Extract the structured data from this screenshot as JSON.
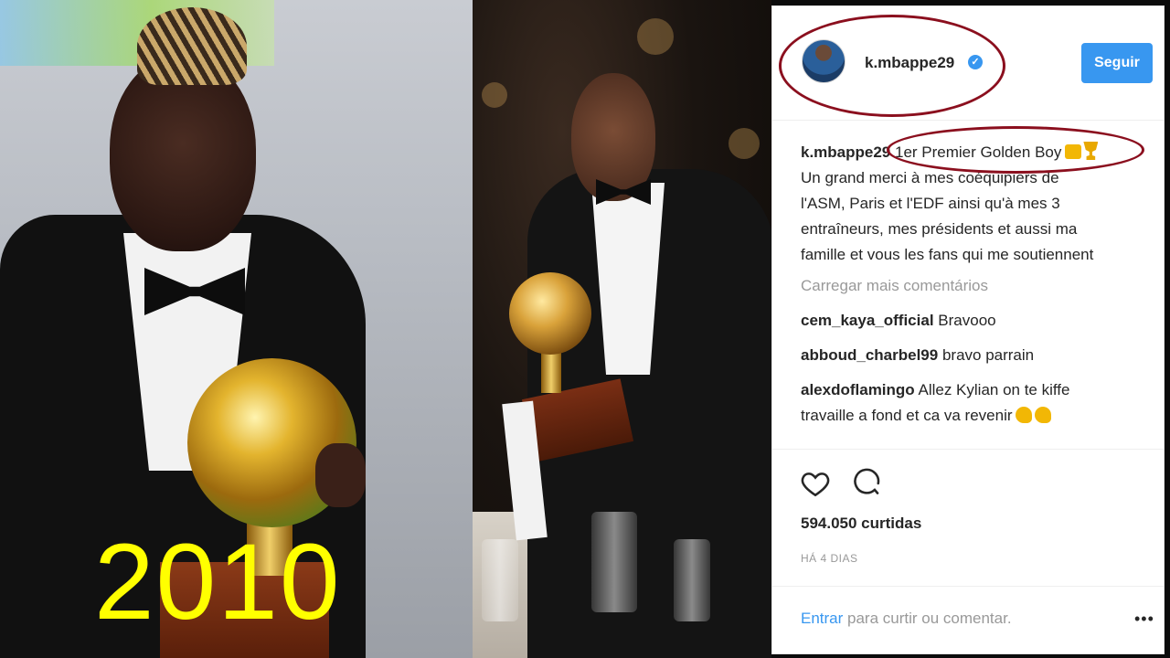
{
  "overlay": {
    "year": "2010"
  },
  "instagram": {
    "username": "k.mbappe29",
    "follow_label": "Seguir",
    "verified_icon": "verified-check-icon",
    "caption": {
      "user": "k.mbappe29",
      "lines": [
        "1er Premier Golden Boy",
        "Un grand merci à mes coéquipiers de",
        "l'ASM, Paris et l'EDF ainsi qu'à mes 3",
        "entraîneurs, mes présidents et aussi ma",
        "famille et vous les fans qui me soutiennent"
      ]
    },
    "load_more": "Carregar mais comentários",
    "comments": [
      {
        "user": "cem_kaya_official",
        "text": "Bravooo"
      },
      {
        "user": "abboud_charbel99",
        "text": "bravo parrain"
      },
      {
        "user": "alexdoflamingo",
        "text": "Allez Kylian on te kiffe",
        "text2": "travaille a fond et ca va revenir"
      }
    ],
    "likes": "594.050 curtidas",
    "time_ago": "HÁ 4 DIAS",
    "login_link": "Entrar",
    "login_text": " para curtir ou comentar.",
    "more_icon": "more-options-icon"
  },
  "colors": {
    "accent": "#3897f0",
    "annotation": "#8b0f1e",
    "year_text": "#ffff00"
  }
}
